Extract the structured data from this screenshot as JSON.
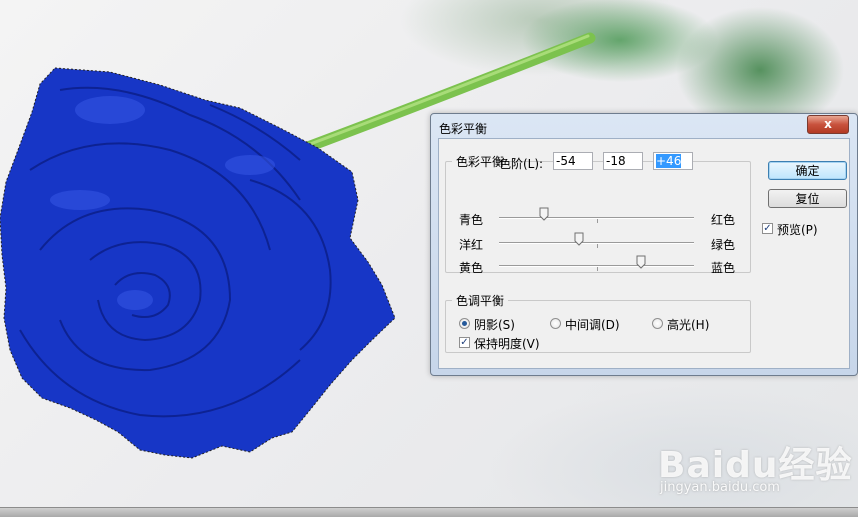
{
  "dialog": {
    "title": "色彩平衡",
    "close_label": "x",
    "color_balance": {
      "legend": "色彩平衡",
      "levels_label": "色阶(L):",
      "levels": [
        "-54",
        "-18",
        "+46"
      ],
      "sliders": [
        {
          "left": "青色",
          "right": "红色",
          "value": -54
        },
        {
          "left": "洋红",
          "right": "绿色",
          "value": -18
        },
        {
          "left": "黄色",
          "right": "蓝色",
          "value": 46
        }
      ]
    },
    "tone_balance": {
      "legend": "色调平衡",
      "options": [
        {
          "label": "阴影(S)",
          "selected": true
        },
        {
          "label": "中间调(D)",
          "selected": false
        },
        {
          "label": "高光(H)",
          "selected": false
        }
      ],
      "preserve_label": "保持明度(V)",
      "preserve_checked": true
    },
    "buttons": {
      "ok": "确定",
      "reset": "复位"
    },
    "preview_label": "预览(P)",
    "preview_checked": true
  },
  "watermark": {
    "logo": "Baidu经验",
    "url": "jingyan.baidu.com"
  },
  "colors": {
    "rose": "#1a35c8",
    "title_bar": "#cfdcee",
    "accent": "#3399ff",
    "close": "#c8523d"
  }
}
